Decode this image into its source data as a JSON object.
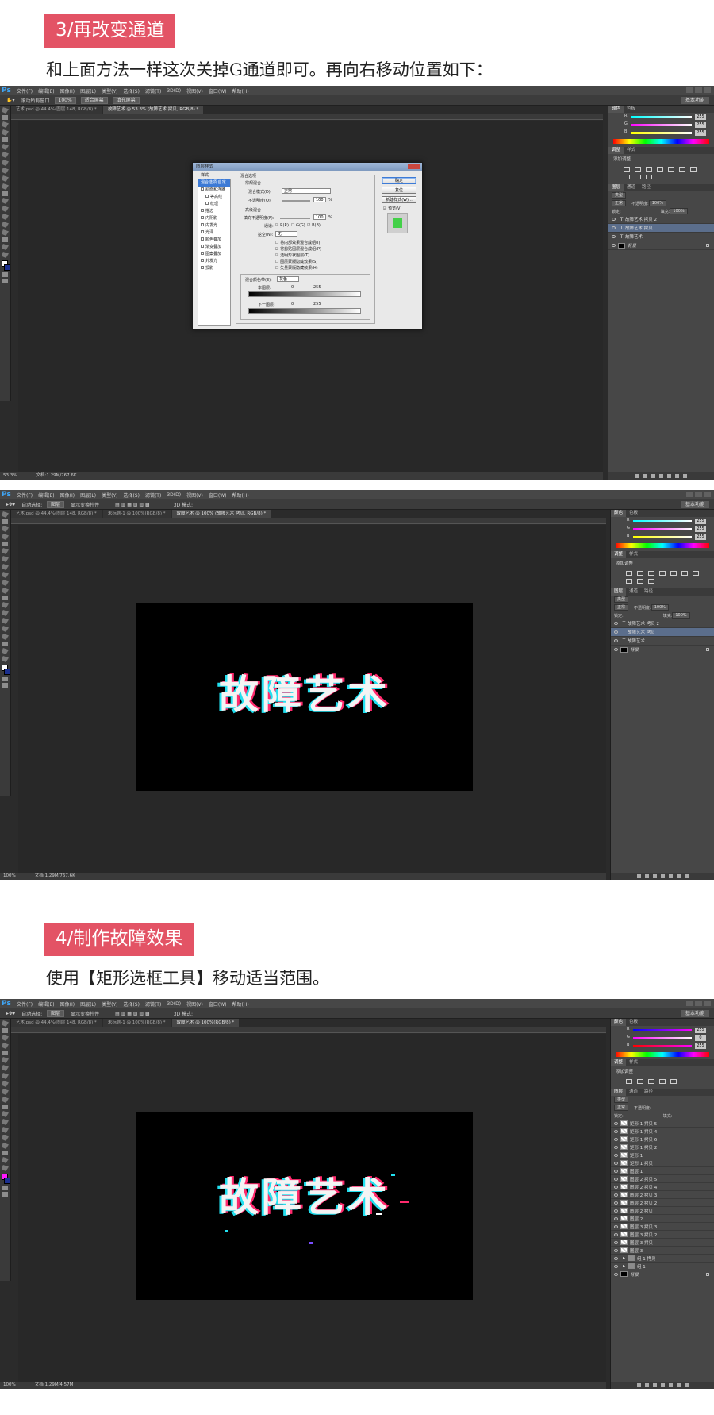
{
  "steps": [
    {
      "heading": "3/再改变通道",
      "desc": "和上面方法一样这次关掉G通道即可。再向右移动位置如下："
    },
    {
      "heading": "4/制作故障效果",
      "desc": "使用【矩形选框工具】移动适当范围。"
    }
  ],
  "ps": {
    "logo": "Ps",
    "menu": [
      "文件(F)",
      "编辑(E)",
      "图像(I)",
      "图层(L)",
      "类型(Y)",
      "选择(S)",
      "滤镜(T)",
      "3D(D)",
      "视图(V)",
      "窗口(W)",
      "帮助(H)"
    ],
    "workspace": "基本功能",
    "swatch_fg_color": "#ffffff",
    "swatch_bg_color": "#1b2f8e",
    "swatch_fg_color_3": "#ff19ff",
    "selected_layer_color": "#5b6e8c"
  },
  "shot1": {
    "options": {
      "tool_label": "滚动所有窗口",
      "zoom": "100%",
      "fit_screen": "适合屏幕",
      "fill_screen": "填充屏幕"
    },
    "tabs": [
      {
        "label": "艺术.psd @ 44.4%(图层 148, RGB/8) *"
      },
      {
        "label": "故障艺术 @ 53.3% (故障艺术 拷贝, RGB/8) *",
        "active": true
      }
    ],
    "status_zoom": "53.3%",
    "status_doc": "文档:1.29M/767.6K",
    "color_tabs": [
      "颜色",
      "色板"
    ],
    "color_values": [
      "255",
      "255",
      "255"
    ],
    "adj_tabs": [
      "调整",
      "样式"
    ],
    "adj_title": "添加调整",
    "layer_tabs": [
      "图层",
      "通道",
      "路径"
    ],
    "layer_kind": "类型",
    "blend_mode": "正常",
    "opacity_label": "不透明度:",
    "opacity_value": "100%",
    "lock_label": "锁定:",
    "fill_label": "填充:",
    "fill_value": "100%",
    "layers": [
      {
        "name": "故障艺术 拷贝 2",
        "kind": "T",
        "selected": false
      },
      {
        "name": "故障艺术 拷贝",
        "kind": "T",
        "selected": true
      },
      {
        "name": "故障艺术",
        "kind": "T",
        "selected": false
      },
      {
        "name": "背景",
        "kind": "bg",
        "selected": false
      }
    ],
    "dialog": {
      "title": "图层样式",
      "styles_header": "样式",
      "list": [
        "混合选项:自定",
        "斜面和浮雕",
        "等高线",
        "纹理",
        "描边",
        "内阴影",
        "内发光",
        "光泽",
        "颜色叠加",
        "渐变叠加",
        "图案叠加",
        "外发光",
        "投影"
      ],
      "group_title": "混合选项",
      "general_title": "常规混合",
      "blend_mode_label": "混合模式(D):",
      "blend_mode_value": "正常",
      "opacity_label": "不透明度(O):",
      "opacity_value": "100",
      "advanced_title": "高级混合",
      "fill_opacity_label": "填充不透明度(F):",
      "fill_opacity_value": "100",
      "pct": "%",
      "channels_label": "通道:",
      "channel_r": "R(R)",
      "channel_g": "G(G)",
      "channel_b": "B(B)",
      "knockout_label": "挖空(N):",
      "knockout_value": "无",
      "options": [
        "将内部效果混合成组(I)",
        "将剪贴图层混合成组(P)",
        "透明形状图层(T)",
        "图层蒙版隐藏效果(S)",
        "矢量蒙版隐藏效果(H)"
      ],
      "blend_if_label": "混合颜色带(E):",
      "blend_if_value": "灰色",
      "this_layer": "本图层:",
      "underlying": "下一图层:",
      "val_0": "0",
      "val_255": "255",
      "ok": "确定",
      "reset": "复位",
      "new_style": "新建样式(W)...",
      "preview": "预览(V)"
    }
  },
  "shot2": {
    "options": {
      "auto_select": "自动选择:",
      "target": "图层",
      "transform": "显示变换控件"
    },
    "tabs": [
      {
        "label": "艺术.psd @ 44.4%(图层 148, RGB/8) *"
      },
      {
        "label": "未标题-1 @ 100%(RGB/8) *"
      },
      {
        "label": "故障艺术 @ 100% (故障艺术 拷贝, RGB/8) *",
        "active": true
      }
    ],
    "mode_3d": "3D 模式:",
    "status_zoom": "100%",
    "status_doc": "文档:1.29M/767.6K",
    "color_values": [
      "255",
      "255",
      "255"
    ],
    "adj_title": "添加调整",
    "canvas_text": "故障艺术",
    "layers": [
      {
        "name": "故障艺术 拷贝 2",
        "kind": "T",
        "selected": false
      },
      {
        "name": "故障艺术 拷贝",
        "kind": "T",
        "selected": true
      },
      {
        "name": "故障艺术",
        "kind": "T",
        "selected": false
      },
      {
        "name": "背景",
        "kind": "bg",
        "selected": false
      }
    ],
    "blend_mode": "正常",
    "opacity_value": "100%",
    "fill_value": "100%"
  },
  "shot3": {
    "tabs": [
      {
        "label": "艺术.psd @ 44.4%(图层 148, RGB/8) *"
      },
      {
        "label": "未标题-1 @ 100%(RGB/8) *"
      },
      {
        "label": "故障艺术 @ 100%(RGB/8) *",
        "active": true
      }
    ],
    "status_zoom": "100%",
    "status_doc": "文档:1.29M/4.57M",
    "color_values": [
      "255",
      "0",
      "255"
    ],
    "adj_title": "添加调整",
    "canvas_text": "故障艺术",
    "layers": [
      {
        "name": "矩形 1 拷贝 5",
        "kind": "shape"
      },
      {
        "name": "矩形 1 拷贝 4",
        "kind": "shape"
      },
      {
        "name": "矩形 1 拷贝 6",
        "kind": "shape"
      },
      {
        "name": "矩形 1 拷贝 2",
        "kind": "shape"
      },
      {
        "name": "矩形 1",
        "kind": "shape"
      },
      {
        "name": "矩形 1 拷贝",
        "kind": "shape"
      },
      {
        "name": "图层 1",
        "kind": "pixel"
      },
      {
        "name": "图层 2 拷贝 5",
        "kind": "pixel"
      },
      {
        "name": "图层 2 拷贝 4",
        "kind": "pixel"
      },
      {
        "name": "图层 2 拷贝 3",
        "kind": "pixel"
      },
      {
        "name": "图层 2 拷贝 2",
        "kind": "pixel"
      },
      {
        "name": "图层 2 拷贝",
        "kind": "pixel"
      },
      {
        "name": "图层 2",
        "kind": "pixel"
      },
      {
        "name": "图层 3 拷贝 3",
        "kind": "pixel"
      },
      {
        "name": "图层 3 拷贝 2",
        "kind": "pixel"
      },
      {
        "name": "图层 3 拷贝",
        "kind": "pixel"
      },
      {
        "name": "图层 3",
        "kind": "pixel"
      },
      {
        "name": "组 1 拷贝",
        "kind": "group"
      },
      {
        "name": "组 1",
        "kind": "group"
      },
      {
        "name": "背景",
        "kind": "bg"
      }
    ]
  }
}
